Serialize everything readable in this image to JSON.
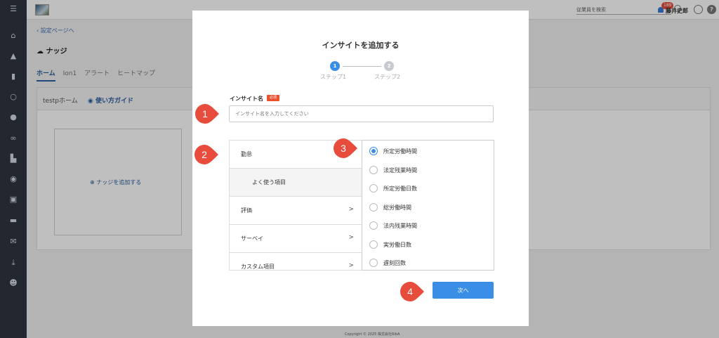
{
  "topbar": {
    "search_placeholder": "従業員を検索",
    "notification_count": "189",
    "user_name": "藤井史郎",
    "help_label": "?"
  },
  "background": {
    "back_link": "設定ページへ",
    "page_title": "ナッジ",
    "tabs": [
      "ホーム",
      "Ion1",
      "アラート",
      "ヒートマップ"
    ],
    "home_label": "testpホーム",
    "guide_link": "使い方ガイド",
    "add_nudge": "ナッジを追加する"
  },
  "modal": {
    "title": "インサイトを追加する",
    "steps": [
      {
        "number": "1",
        "label": "ステップ1",
        "active": true
      },
      {
        "number": "2",
        "label": "ステップ2",
        "active": false
      }
    ],
    "field_label": "インサイト名",
    "required_tag": "必須",
    "name_placeholder": "インサイト名を入力してください",
    "categories": [
      {
        "label": "勤怠",
        "chevron": ""
      },
      {
        "label": "よく使う項目",
        "chevron": "",
        "sub": true
      },
      {
        "label": "評価",
        "chevron": ">"
      },
      {
        "label": "サーベイ",
        "chevron": ">"
      },
      {
        "label": "カスタム項目",
        "chevron": ">"
      }
    ],
    "options": [
      {
        "label": "所定労働時間",
        "selected": true
      },
      {
        "label": "法定残業時間",
        "selected": false
      },
      {
        "label": "所定労働日数",
        "selected": false
      },
      {
        "label": "総労働時間",
        "selected": false
      },
      {
        "label": "法内残業時間",
        "selected": false
      },
      {
        "label": "実労働日数",
        "selected": false
      },
      {
        "label": "遅刻回数",
        "selected": false
      }
    ],
    "next_button": "次へ"
  },
  "markers": [
    "1",
    "2",
    "3",
    "4"
  ],
  "footer": "Copyright © 2025 株式会社RibA",
  "colors": {
    "accent": "#3a8ee6",
    "marker": "#e84c3d",
    "required": "#e8512a"
  }
}
